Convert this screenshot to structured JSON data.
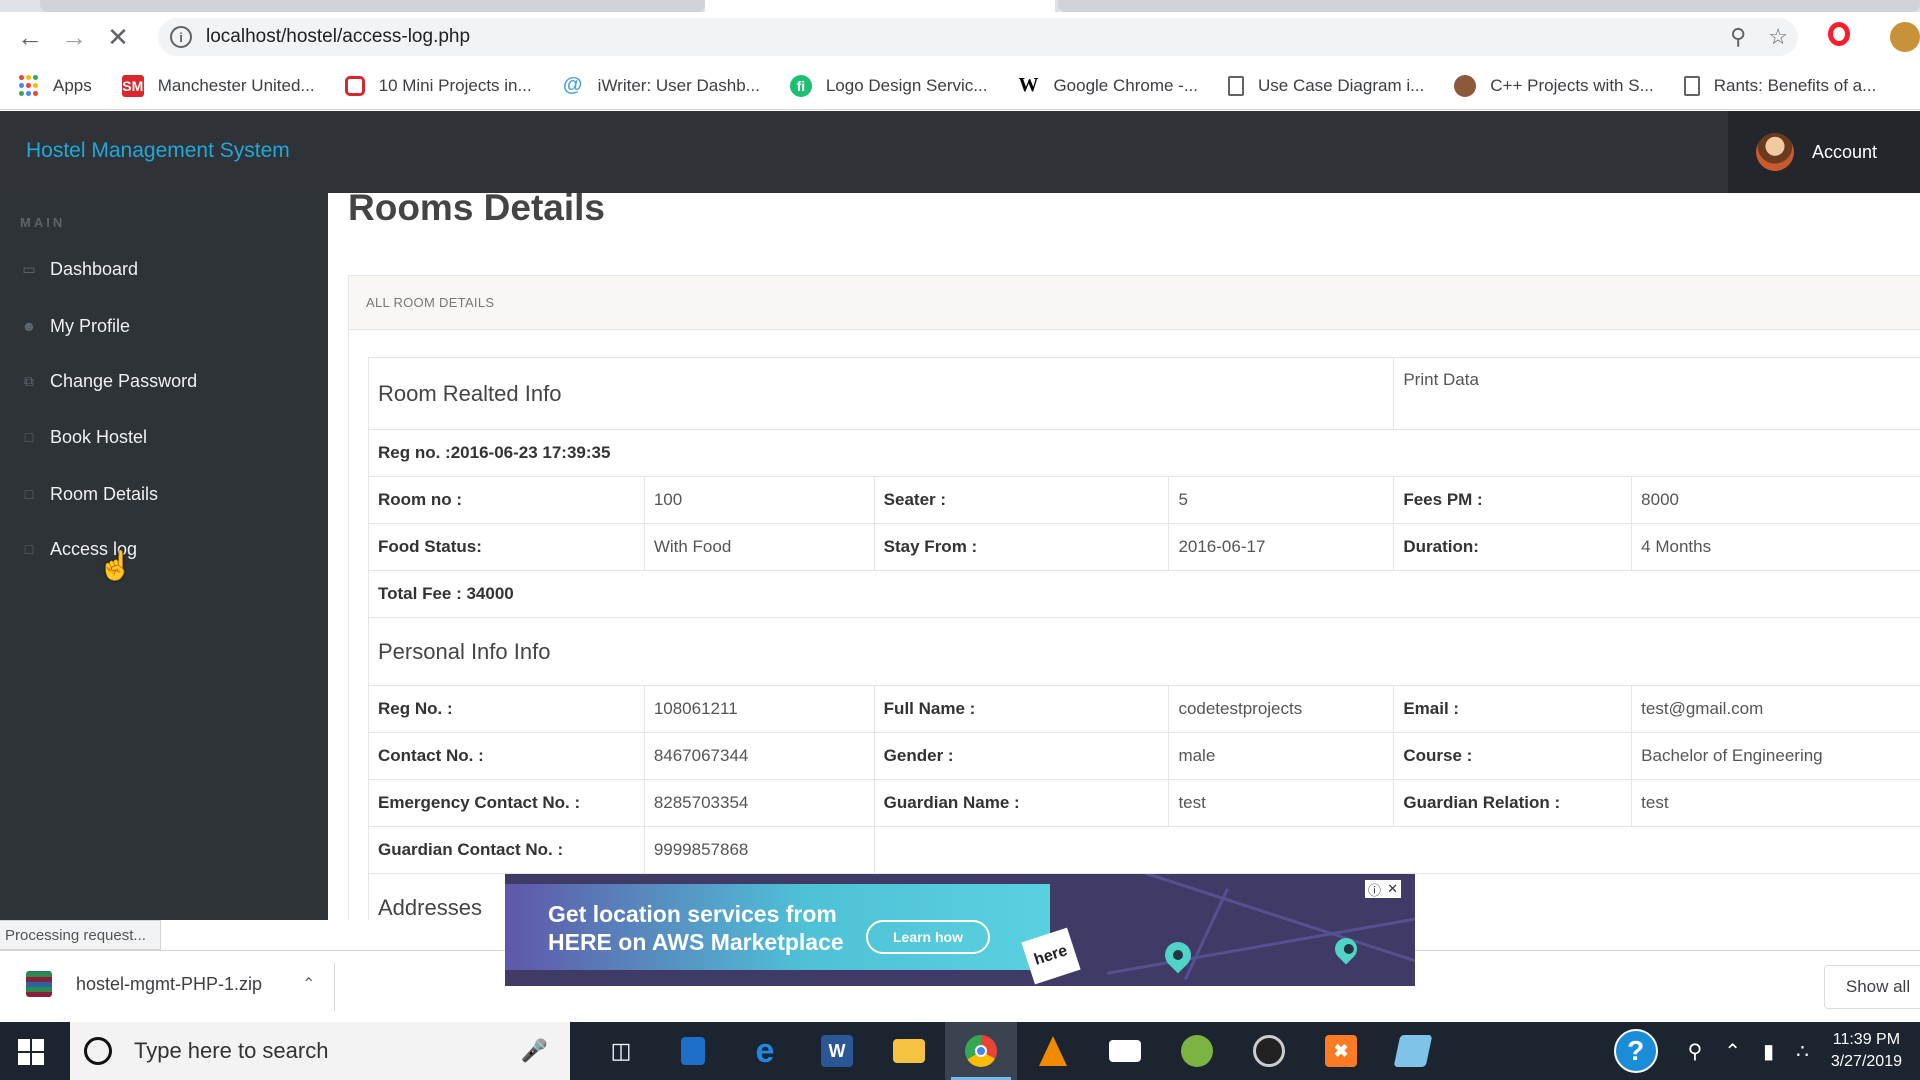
{
  "browser": {
    "url": "localhost/hostel/access-log.php",
    "bookmarks": [
      {
        "label": "Apps",
        "icon": "apps-grid-icon",
        "color": "#e8453c"
      },
      {
        "label": "Manchester United...",
        "icon": "sm-icon",
        "color": "#d9272e"
      },
      {
        "label": "10 Mini Projects in...",
        "icon": "ring-icon",
        "color": "#d9272e"
      },
      {
        "label": "iWriter: User Dashb...",
        "icon": "at-icon",
        "color": "#4aa3df"
      },
      {
        "label": "Logo Design Servic...",
        "icon": "fiverr-icon",
        "color": "#1dbf73"
      },
      {
        "label": "Google Chrome -...",
        "icon": "wikipedia-icon",
        "color": "#000000"
      },
      {
        "label": "Use Case Diagram i...",
        "icon": "page-icon",
        "color": "#5f6368"
      },
      {
        "label": "C++ Projects with S...",
        "icon": "avatar-icon",
        "color": "#8a5a3a"
      },
      {
        "label": "Rants: Benefits of a...",
        "icon": "page-icon",
        "color": "#5f6368"
      }
    ]
  },
  "header": {
    "brand": "Hostel Management System",
    "account": "Account"
  },
  "sidebar": {
    "heading": "MAIN",
    "items": [
      {
        "label": "Dashboard",
        "icon": "desktop-icon"
      },
      {
        "label": "My Profile",
        "icon": "user-icon"
      },
      {
        "label": "Change Password",
        "icon": "files-icon"
      },
      {
        "label": "Book Hostel",
        "icon": "file-icon"
      },
      {
        "label": "Room Details",
        "icon": "file-icon"
      },
      {
        "label": "Access log",
        "icon": "file-icon"
      }
    ]
  },
  "main": {
    "title": "Rooms Details",
    "panel_heading": "ALL ROOM DETAILS",
    "room_section": "Room Realted Info",
    "print_link": "Print Data",
    "reg_line": "Reg no. :2016-06-23 17:39:35",
    "room_no_label": "Room no :",
    "room_no": "100",
    "seater_label": "Seater :",
    "seater": "5",
    "fees_label": "Fees PM :",
    "fees": "8000",
    "food_label": "Food Status:",
    "food": "With Food",
    "stay_label": "Stay From :",
    "stay": "2016-06-17",
    "duration_label": "Duration:",
    "duration": "4 Months",
    "total_fee": "Total Fee : 34000",
    "personal_section": "Personal Info Info",
    "regno_label": "Reg No. :",
    "regno": "108061211",
    "fullname_label": "Full Name :",
    "fullname": "codetestprojects",
    "email_label": "Email :",
    "email": "test@gmail.com",
    "contact_label": "Contact No. :",
    "contact": "8467067344",
    "gender_label": "Gender :",
    "gender": "male",
    "course_label": "Course :",
    "course": "Bachelor of Engineering",
    "emergency_label": "Emergency Contact No. :",
    "emergency": "8285703354",
    "guardian_name_label": "Guardian Name :",
    "guardian_name": "test",
    "guardian_rel_label": "Guardian Relation :",
    "guardian_rel": "test",
    "guardian_contact_label": "Guardian Contact No. :",
    "guardian_contact": "9999857868",
    "addresses_section": "Addresses"
  },
  "status_text": "Processing request...",
  "ad": {
    "text": "Get location services from HERE on AWS Marketplace",
    "button": "Learn how",
    "logo": "here"
  },
  "download": {
    "filename": "hostel-mgmt-PHP-1.zip",
    "show_all": "Show all"
  },
  "taskbar": {
    "search_placeholder": "Type here to search",
    "time": "11:39 PM",
    "date": "3/27/2019"
  }
}
